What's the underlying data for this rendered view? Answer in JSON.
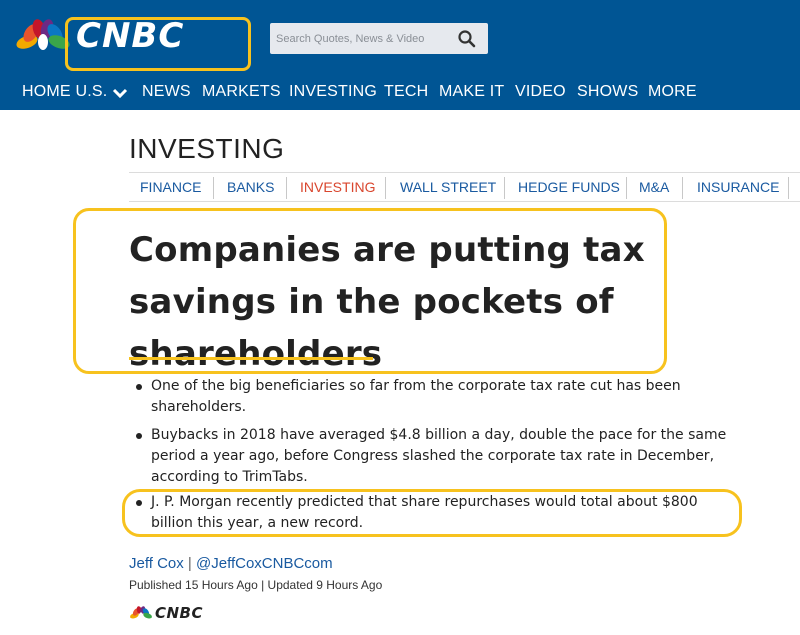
{
  "brand": {
    "logo_text": "CNBC",
    "primary_color": "#005594",
    "highlight_color": "#f7c21e",
    "peacock_colors": [
      "#f2a900",
      "#e8542c",
      "#c4162a",
      "#6d2a84",
      "#0b77c4",
      "#3aa54a"
    ]
  },
  "search": {
    "placeholder": "Search Quotes, News & Video",
    "icon": "search-icon"
  },
  "nav": {
    "items": [
      "HOME U.S.",
      "NEWS",
      "MARKETS",
      "INVESTING",
      "TECH",
      "MAKE IT",
      "VIDEO",
      "SHOWS",
      "MORE"
    ],
    "dropdown_icon": "chevron-down-icon"
  },
  "section": {
    "title": "INVESTING",
    "subnav": [
      "FINANCE",
      "BANKS",
      "INVESTING",
      "WALL STREET",
      "HEDGE FUNDS",
      "M&A",
      "INSURANCE"
    ],
    "active": "INVESTING"
  },
  "article": {
    "headline": "Companies are putting tax savings in the pockets of shareholders",
    "bullets": [
      "One of the big beneficiaries so far from the corporate tax rate cut has been shareholders.",
      "Buybacks in 2018 have averaged $4.8 billion a day, double the pace for the same period a year ago, before Congress slashed the corporate tax rate in December, according to TrimTabs.",
      "J. P. Morgan recently predicted that share repurchases would total about $800 billion this year, a new record."
    ],
    "author": "Jeff Cox",
    "author_separator": "|",
    "author_handle": "@JeffCoxCNBCcom",
    "published": "Published 15 Hours Ago | Updated 9 Hours Ago",
    "footer_logo_text": "CNBC"
  }
}
